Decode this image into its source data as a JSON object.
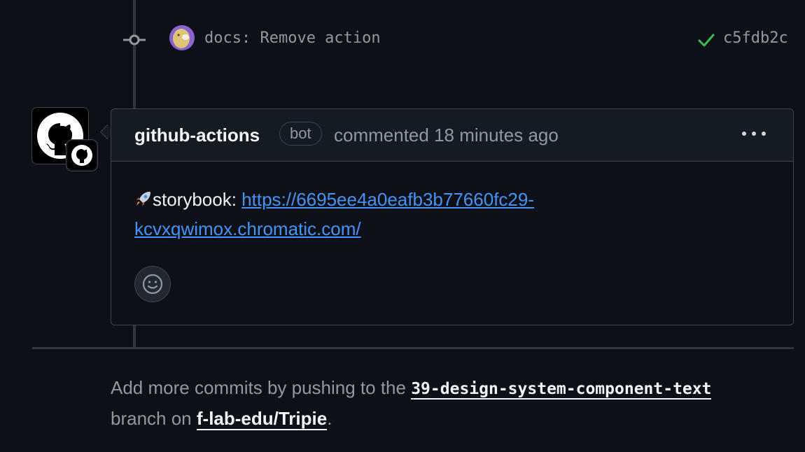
{
  "commit": {
    "message": "docs: Remove action",
    "sha": "c5fdb2c",
    "status": "success",
    "icons": {
      "node": "git-commit-icon",
      "status": "check-icon",
      "avatar": "user-avatar"
    }
  },
  "comment": {
    "author": "github-actions",
    "badge": "bot",
    "meta": "commented 18 minutes ago",
    "body_prefix": "storybook: ",
    "link_line1": "https://6695ee4a0eafb3b77660fc29-",
    "link_line2": "kcvxqwimox.chromatic.com/",
    "link_href": "https://6695ee4a0eafb3b77660fc29-kcvxqwimox.chromatic.com/",
    "icons": {
      "emoji": "rocket-icon",
      "menu": "kebab-menu-icon",
      "reaction": "smiley-icon",
      "avatar": "github-logo-icon"
    }
  },
  "footer": {
    "text_before": "Add more commits by pushing to the ",
    "branch": "39-design-system-component-text",
    "text_middle": "branch on ",
    "repo": "f-lab-edu/Tripie",
    "text_after": "."
  },
  "colors": {
    "background": "#0d1117",
    "border": "#3d444d",
    "link": "#4493f8",
    "success": "#3fb950",
    "muted": "#9198a1"
  }
}
